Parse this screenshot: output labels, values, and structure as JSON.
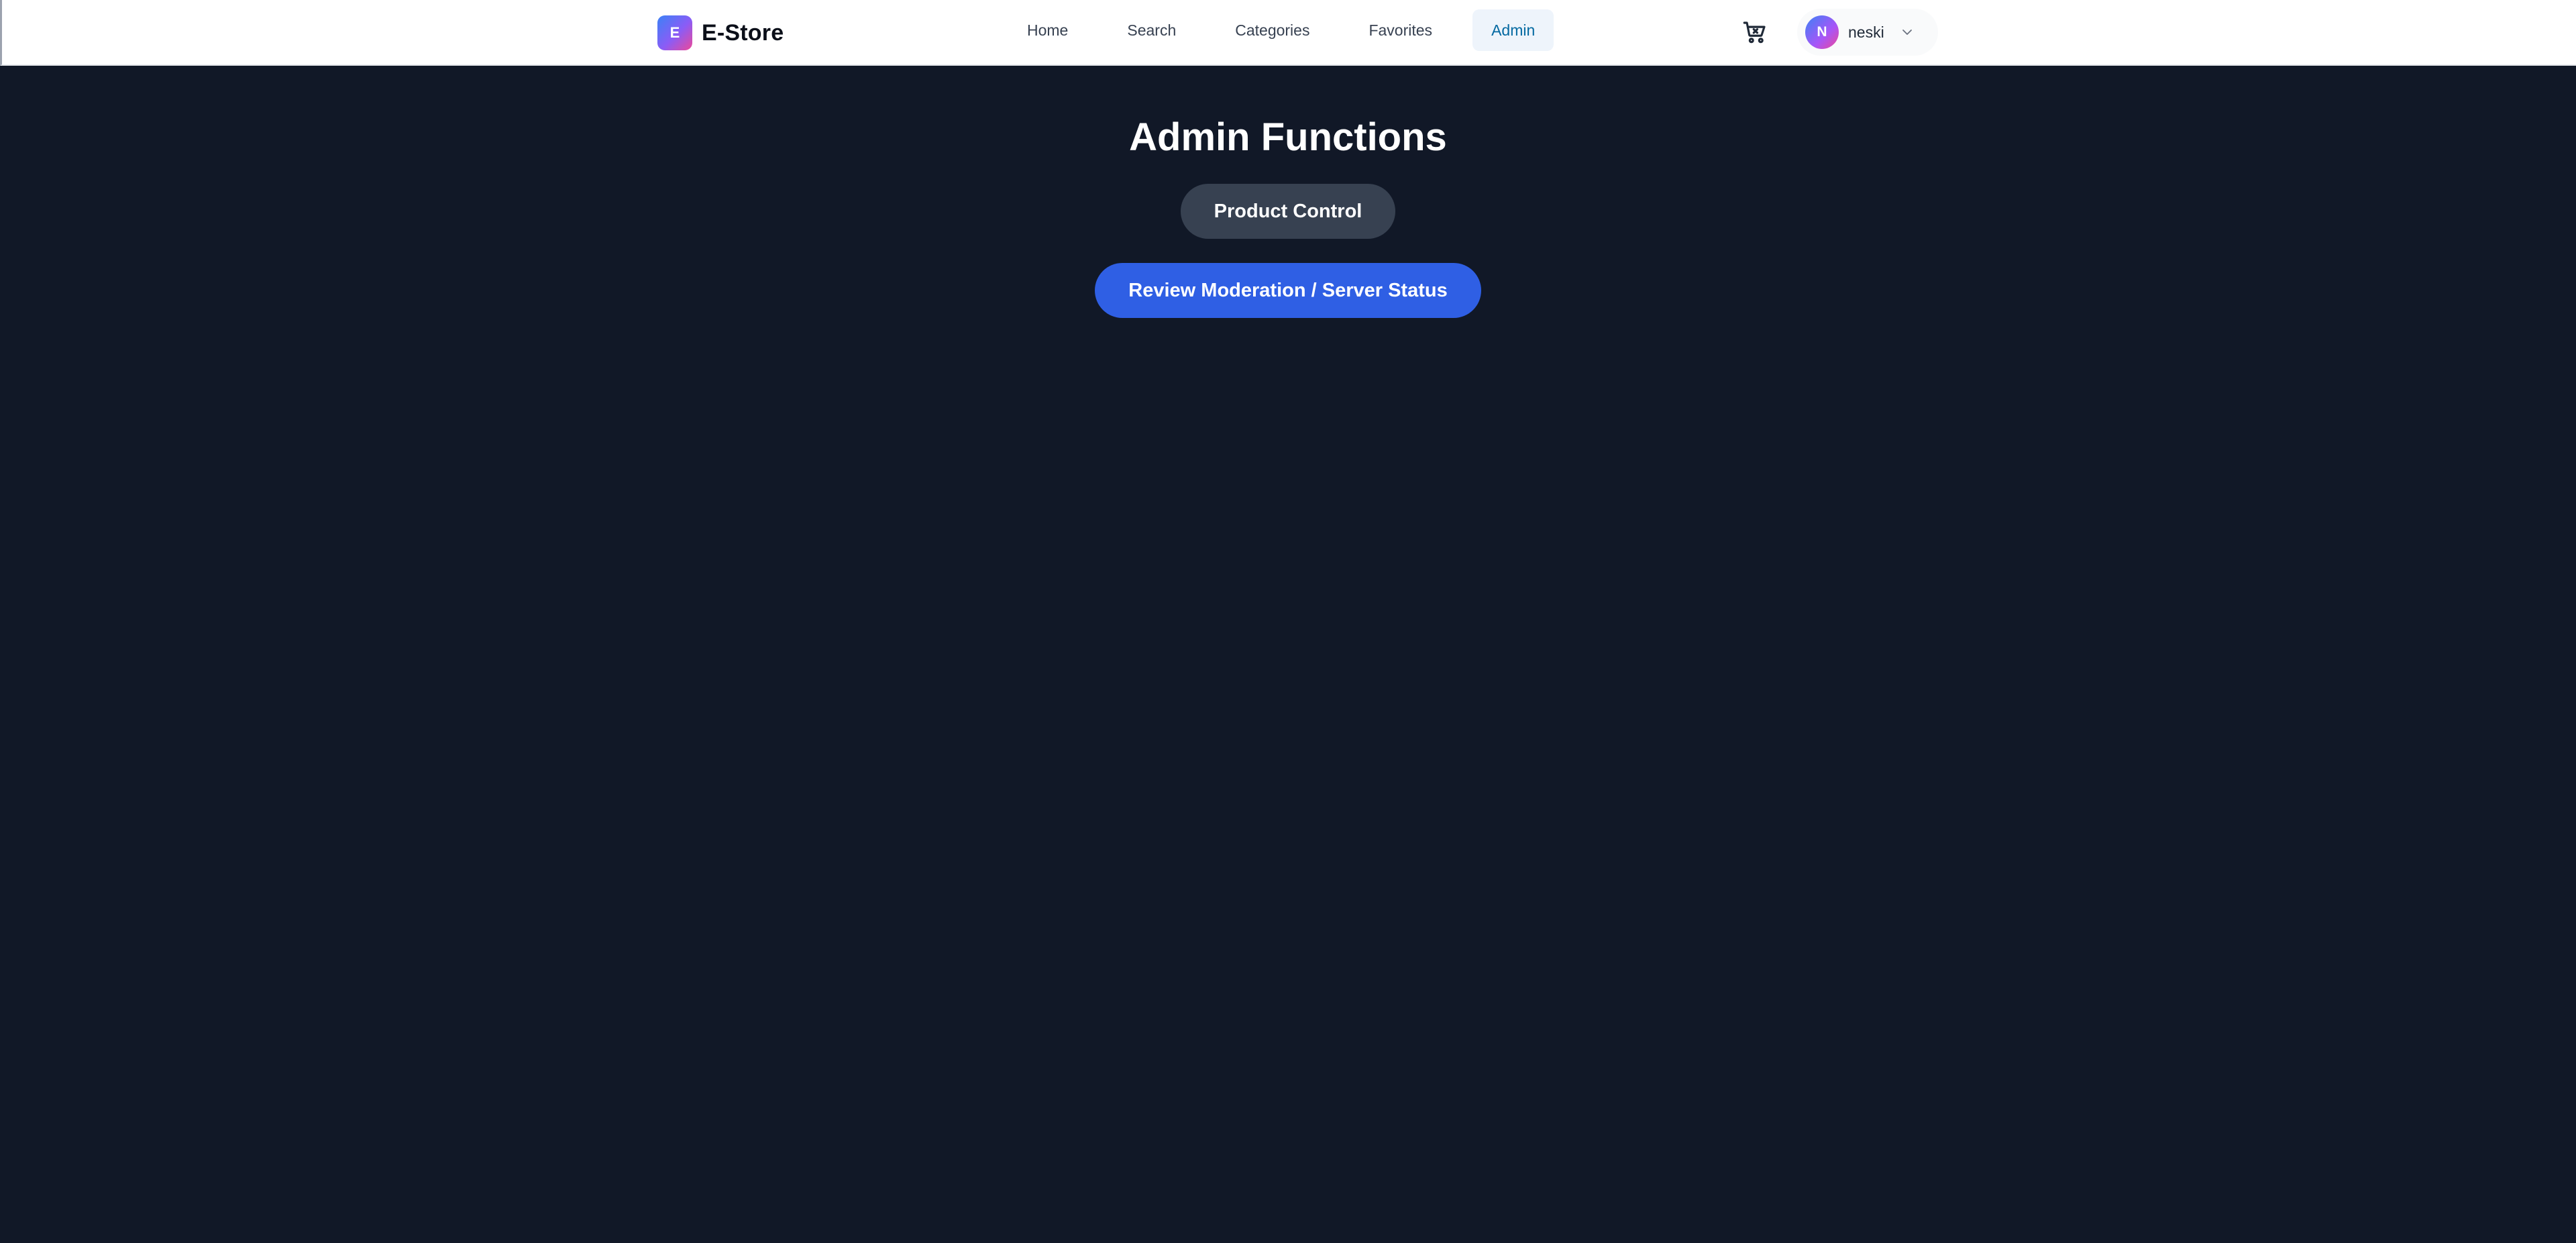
{
  "header": {
    "brand": {
      "logo_letter": "E",
      "name": "E-Store"
    },
    "nav": [
      {
        "label": "Home",
        "active": false
      },
      {
        "label": "Search",
        "active": false
      },
      {
        "label": "Categories",
        "active": false
      },
      {
        "label": "Favorites",
        "active": false
      },
      {
        "label": "Admin",
        "active": true
      }
    ],
    "cart_icon": "shopping-cart-icon",
    "user": {
      "avatar_letter": "N",
      "name": "neski",
      "dropdown_icon": "chevron-down-icon"
    }
  },
  "main": {
    "title": "Admin Functions",
    "buttons": {
      "product_control": "Product Control",
      "review_moderation": "Review Moderation / Server Status"
    }
  },
  "colors": {
    "page_background": "#111827",
    "header_background": "#ffffff",
    "accent": "#2f5fe4",
    "secondary_button": "#374151",
    "active_nav_text": "#0369a1",
    "active_nav_background": "#eef4fb"
  }
}
